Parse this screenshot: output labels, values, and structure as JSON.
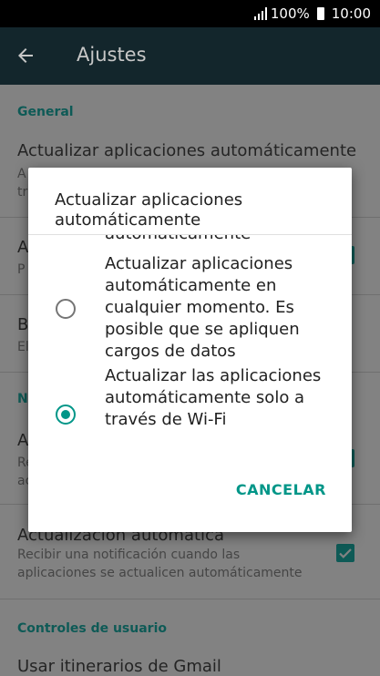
{
  "status_bar": {
    "battery": "100%",
    "time": "10:00"
  },
  "app_bar": {
    "title": "Ajustes"
  },
  "settings": {
    "general_header": "General",
    "auto_update": {
      "title": "Actualizar aplicaciones automáticamente",
      "sub_partial": "A",
      "sub_partial2": "tr"
    },
    "item2": {
      "title_partial": "A",
      "sub_partial": "P"
    },
    "item3": {
      "title_partial": "B",
      "sub_partial": "El"
    },
    "notif_header_partial": "N",
    "item4": {
      "title_partial": "A",
      "sub_partial": "Re",
      "sub_partial2": "ac"
    },
    "auto_update_notice": {
      "title": "Actualización automática",
      "sub": "Recibir una notificación cuando las aplicaciones se actualicen automáticamente",
      "checked": true
    },
    "user_controls_header": "Controles de usuario",
    "gmail_item": {
      "title": "Usar itinerarios de Gmail"
    }
  },
  "dialog": {
    "title": "Actualizar aplicaciones automáticamente",
    "cut_option_text": "automáticamente",
    "options": [
      {
        "label": "Actualizar aplicaciones automáticamente en cualquier momento. Es posible que se apliquen cargos de datos",
        "selected": false
      },
      {
        "label": "Actualizar las aplicaciones automáticamente solo a través de Wi-Fi",
        "selected": true
      }
    ],
    "cancel_label": "CANCELAR"
  },
  "colors": {
    "accent": "#009688",
    "appbar": "#13262c",
    "scrim_bg": "#828282"
  }
}
